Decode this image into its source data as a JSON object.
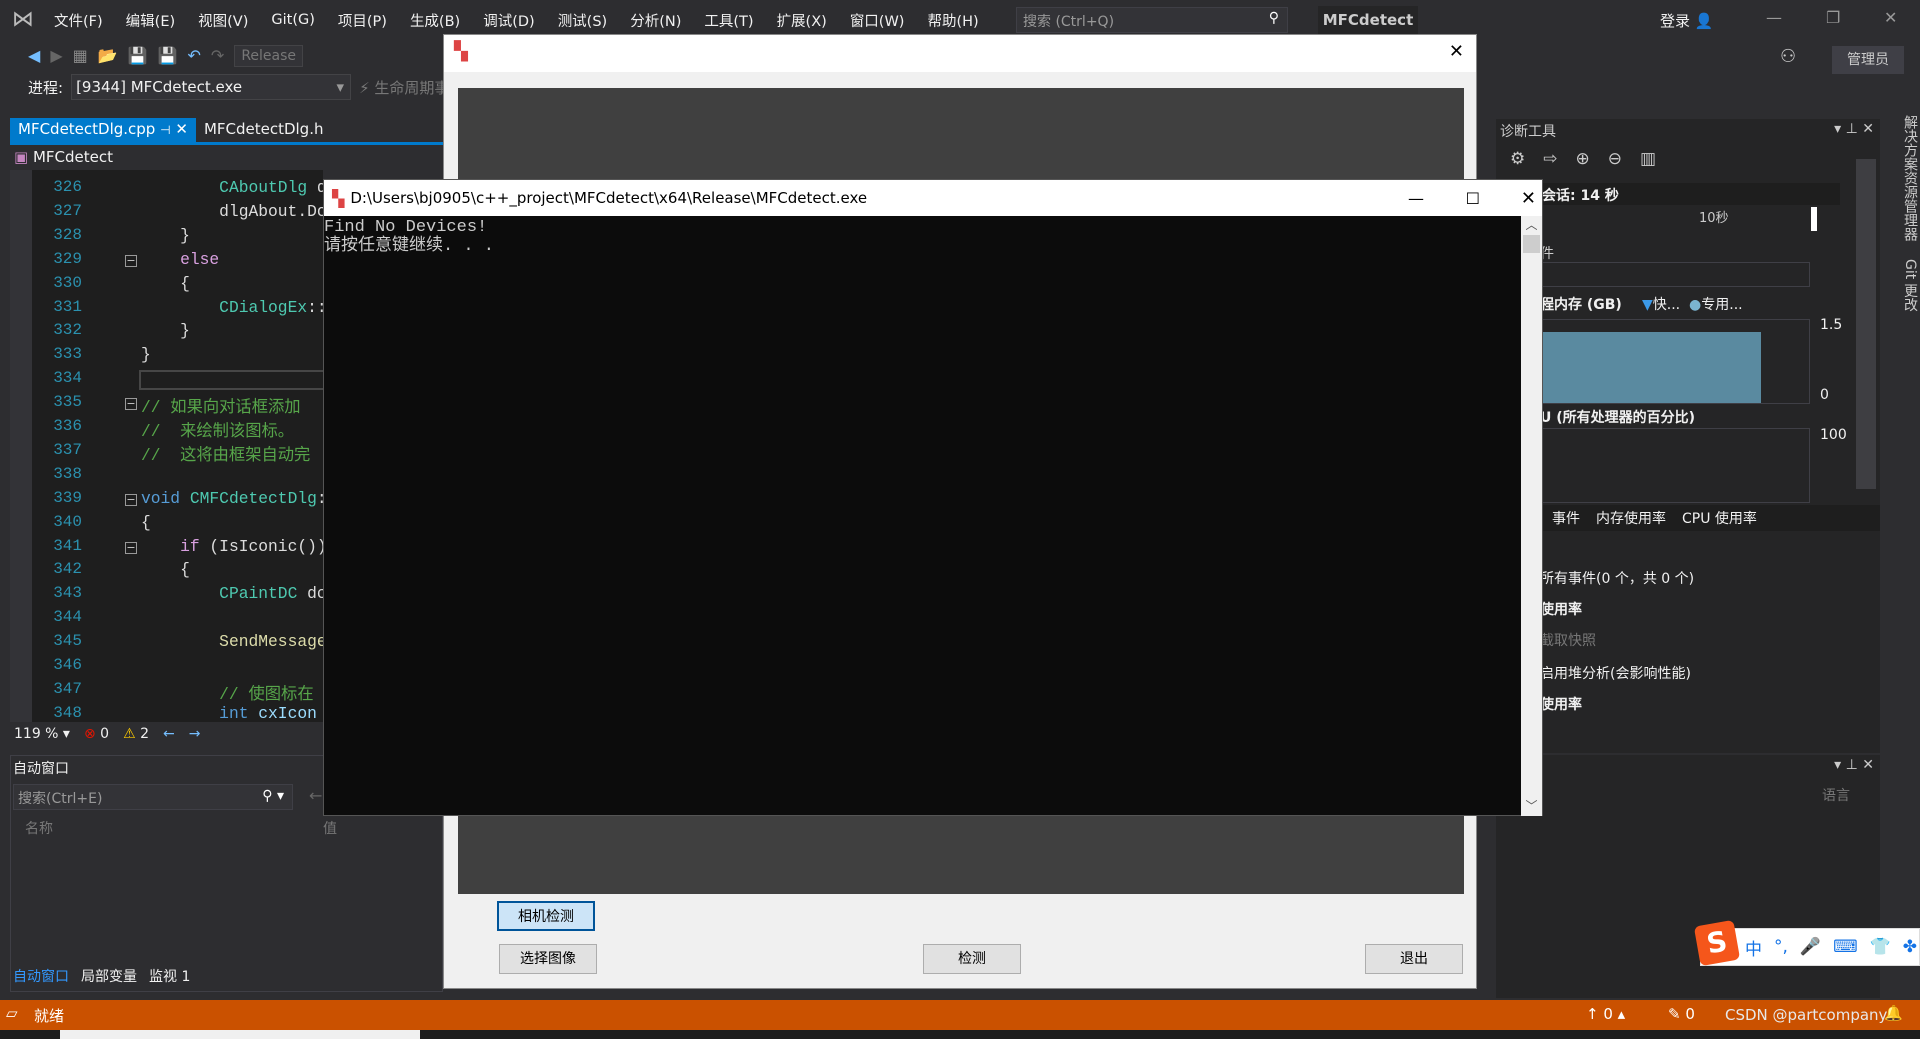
{
  "menu": {
    "items": [
      "文件(F)",
      "编辑(E)",
      "视图(V)",
      "Git(G)",
      "项目(P)",
      "生成(B)",
      "调试(D)",
      "测试(S)",
      "分析(N)",
      "工具(T)",
      "扩展(X)",
      "窗口(W)",
      "帮助(H)"
    ],
    "search_placeholder": "搜索 (Ctrl+Q)",
    "solution_name": "MFCdetect",
    "login": "登录",
    "admin": "管理员"
  },
  "toolbar": {
    "configuration": "Release"
  },
  "process": {
    "label": "进程:",
    "value": "[9344] MFCdetect.exe",
    "lifecycle": "生命周期事件"
  },
  "editor": {
    "tabs": [
      {
        "label": "MFCdetectDlg.cpp",
        "active": true
      },
      {
        "label": "MFCdetectDlg.h",
        "active": false
      }
    ],
    "nav_scope": "MFCdetect",
    "lines": [
      {
        "n": "326",
        "tokens": [
          {
            "t": "        ",
            "c": "pl"
          },
          {
            "t": "CAboutDlg",
            "c": "ty"
          },
          {
            "t": " dlgAbout;",
            "c": "pl"
          }
        ]
      },
      {
        "n": "327",
        "tokens": [
          {
            "t": "        dlgAbout.DoModal();",
            "c": "pl"
          }
        ]
      },
      {
        "n": "328",
        "tokens": [
          {
            "t": "    }",
            "c": "pl"
          }
        ]
      },
      {
        "n": "329",
        "fold": true,
        "tokens": [
          {
            "t": "    ",
            "c": "pl"
          },
          {
            "t": "else",
            "c": "ctl"
          }
        ]
      },
      {
        "n": "330",
        "tokens": [
          {
            "t": "    {",
            "c": "pl"
          }
        ]
      },
      {
        "n": "331",
        "tokens": [
          {
            "t": "        ",
            "c": "pl"
          },
          {
            "t": "CDialogEx",
            "c": "ty"
          },
          {
            "t": "::",
            "c": "pl"
          }
        ]
      },
      {
        "n": "332",
        "tokens": [
          {
            "t": "    }",
            "c": "pl"
          }
        ]
      },
      {
        "n": "333",
        "tokens": [
          {
            "t": "}",
            "c": "pl"
          }
        ]
      },
      {
        "n": "334",
        "current": true,
        "tokens": []
      },
      {
        "n": "335",
        "fold": true,
        "tokens": [
          {
            "t": "// 如果向对话框添加",
            "c": "cmt"
          }
        ]
      },
      {
        "n": "336",
        "tokens": [
          {
            "t": "//  来绘制该图标。",
            "c": "cmt"
          }
        ]
      },
      {
        "n": "337",
        "tokens": [
          {
            "t": "//  这将由框架自动完",
            "c": "cmt"
          }
        ]
      },
      {
        "n": "338",
        "tokens": []
      },
      {
        "n": "339",
        "fold": true,
        "tokens": [
          {
            "t": "void",
            "c": "kw"
          },
          {
            "t": " ",
            "c": "pl"
          },
          {
            "t": "CMFCdetectDlg",
            "c": "ty"
          },
          {
            "t": "::",
            "c": "pl"
          }
        ]
      },
      {
        "n": "340",
        "tokens": [
          {
            "t": "{",
            "c": "pl"
          }
        ]
      },
      {
        "n": "341",
        "fold": true,
        "tokens": [
          {
            "t": "    ",
            "c": "pl"
          },
          {
            "t": "if",
            "c": "ctl"
          },
          {
            "t": " (IsIconic())",
            "c": "pl"
          }
        ]
      },
      {
        "n": "342",
        "tokens": [
          {
            "t": "    {",
            "c": "pl"
          }
        ]
      },
      {
        "n": "343",
        "tokens": [
          {
            "t": "        ",
            "c": "pl"
          },
          {
            "t": "CPaintDC",
            "c": "ty"
          },
          {
            "t": " dc",
            "c": "pl"
          }
        ]
      },
      {
        "n": "344",
        "tokens": []
      },
      {
        "n": "345",
        "tokens": [
          {
            "t": "        ",
            "c": "pl"
          },
          {
            "t": "SendMessage",
            "c": "fn"
          }
        ]
      },
      {
        "n": "346",
        "tokens": []
      },
      {
        "n": "347",
        "tokens": [
          {
            "t": "        // 使图标在",
            "c": "cmt"
          }
        ]
      },
      {
        "n": "348",
        "tokens": [
          {
            "t": "        ",
            "c": "pl"
          },
          {
            "t": "int",
            "c": "kw"
          },
          {
            "t": " ",
            "c": "pl"
          },
          {
            "t": "cxIcon",
            "c": "var"
          }
        ]
      }
    ],
    "zoom": "119 %",
    "errors": "0",
    "warnings": "2"
  },
  "auto_window": {
    "title": "自动窗口",
    "search_placeholder": "搜索(Ctrl+E)",
    "columns": [
      "名称",
      "值"
    ],
    "tabs": [
      "自动窗口",
      "局部变量",
      "监视 1"
    ]
  },
  "diagnostics": {
    "title": "诊断工具",
    "session": "会话: 14 秒",
    "timeline_tick": "10秒",
    "events_label": "件",
    "memory_title": "程内存 (GB)",
    "legend": [
      "快...",
      "专用..."
    ],
    "mem_axis": [
      "1.5",
      "0"
    ],
    "cpu_title": "U (所有处理器的百分比)",
    "cpu_axis": [
      "100"
    ],
    "tabs": [
      "事件",
      "内存使用率",
      "CPU 使用率"
    ],
    "rows": [
      "所有事件(0 个，共 0 个)",
      "使用率",
      "截取快照",
      "启用堆分析(会影响性能)",
      "使用率"
    ],
    "memory_fill": 0.85
  },
  "side_tabs": [
    "解决方案资源管理器",
    "Git 更改"
  ],
  "lower_panel": {
    "column": "语言"
  },
  "mfc_dialog": {
    "buttons": {
      "camera": "相机检测",
      "select_image": "选择图像",
      "detect": "检测",
      "exit": "退出"
    }
  },
  "console": {
    "title": "D:\\Users\\bj0905\\c++_project\\MFCdetect\\x64\\Release\\MFCdetect.exe",
    "output": [
      "Find No Devices!",
      "请按任意键继续. . ."
    ]
  },
  "statusbar": {
    "status": "就绪",
    "up_count": "0",
    "edit_count": "0",
    "watermark": "CSDN @partcompany1"
  },
  "ime": {
    "mode": "中",
    "punct": "°,"
  },
  "colors": {
    "accent": "#007acc",
    "statusbar": "#ca5100",
    "memory_fill": "#5a8aa0"
  }
}
